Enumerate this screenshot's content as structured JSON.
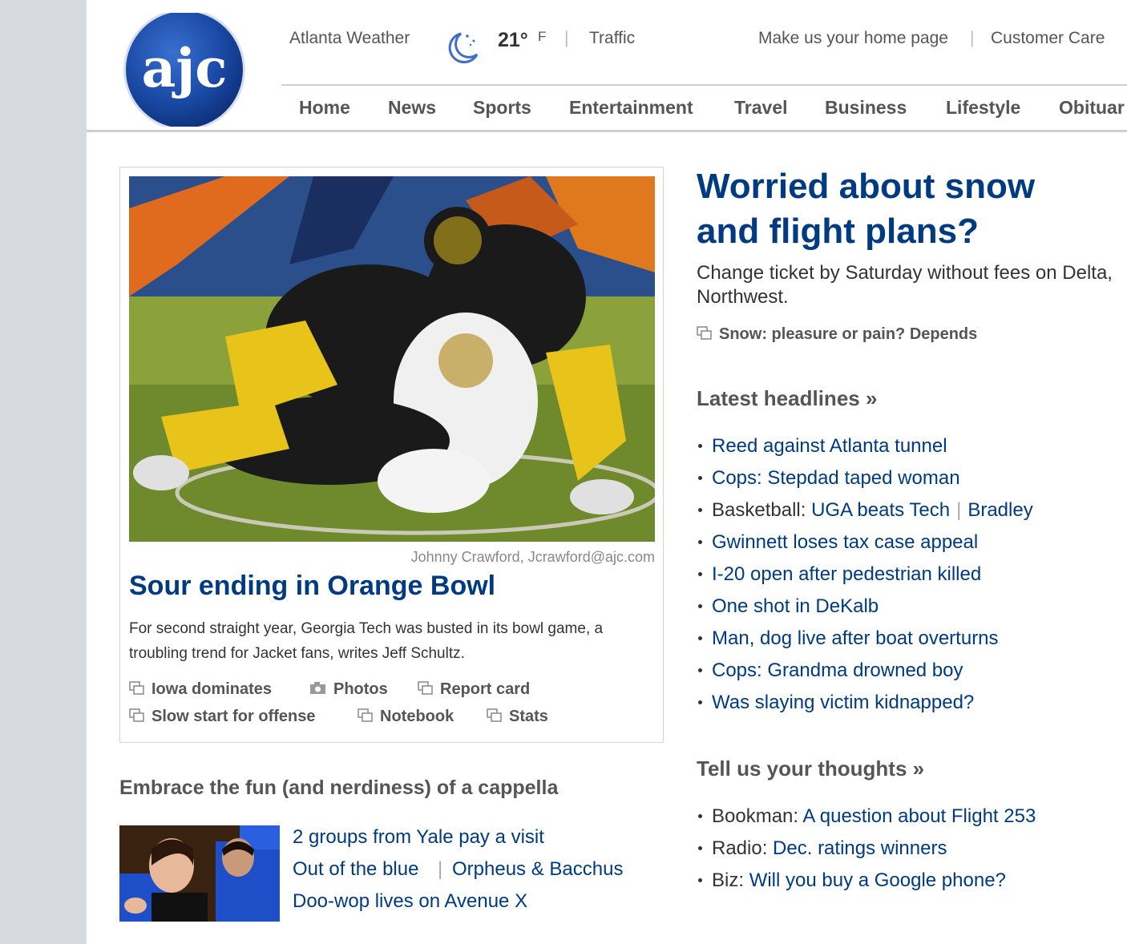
{
  "header": {
    "logo_text": "ajc",
    "weather_label": "Atlanta Weather",
    "weather_icon": "moon-night-icon",
    "temperature": "21°",
    "temperature_unit": "F",
    "separator": "|",
    "traffic_label": "Traffic",
    "homepage_label": "Make us your home page",
    "customer_care_label": "Customer Care"
  },
  "nav": {
    "items": [
      {
        "label": "Home"
      },
      {
        "label": "News"
      },
      {
        "label": "Sports"
      },
      {
        "label": "Entertainment"
      },
      {
        "label": "Travel"
      },
      {
        "label": "Business"
      },
      {
        "label": "Lifestyle"
      },
      {
        "label": "Obituar"
      }
    ]
  },
  "main_story": {
    "photo_credit": "Johnny Crawford, Jcrawford@ajc.com",
    "title": "Sour ending in Orange Bowl",
    "description": "For second straight year, Georgia Tech was busted in its bowl game, a troubling trend for Jacket fans, writes Jeff Schultz.",
    "related": [
      {
        "label": "Iowa dominates",
        "icon": "article-icon"
      },
      {
        "label": "Photos",
        "icon": "camera-icon"
      },
      {
        "label": "Report card",
        "icon": "article-icon"
      },
      {
        "label": "Slow start for offense",
        "icon": "article-icon"
      },
      {
        "label": "Notebook",
        "icon": "article-icon"
      },
      {
        "label": "Stats",
        "icon": "article-icon"
      }
    ]
  },
  "acappella": {
    "title": "Embrace the fun (and nerdiness) of a cappella",
    "links": [
      "2 groups from Yale pay a visit",
      "Out of the blue",
      "Orpheus & Bacchus",
      "Doo-wop lives on Avenue X"
    ],
    "separator": "|"
  },
  "promo": {
    "title": "Worried about snow and flight plans?",
    "description": "Change ticket by Saturday without fees on Delta, Northwest.",
    "related_link": "Snow: pleasure or pain? Depends"
  },
  "latest": {
    "title": "Latest headlines »",
    "items": [
      {
        "prefix": "",
        "link": "Reed against Atlanta tunnel"
      },
      {
        "prefix": "",
        "link": "Cops: Stepdad taped woman"
      },
      {
        "prefix": "Basketball: ",
        "link": "UGA beats Tech",
        "separator": "|",
        "link2": "Bradley"
      },
      {
        "prefix": "",
        "link": "Gwinnett loses tax case appeal"
      },
      {
        "prefix": "",
        "link": "I-20 open after pedestrian killed"
      },
      {
        "prefix": "",
        "link": "One shot in DeKalb"
      },
      {
        "prefix": "",
        "link": "Man, dog live after boat overturns"
      },
      {
        "prefix": "",
        "link": "Cops: Grandma drowned boy"
      },
      {
        "prefix": "",
        "link": "Was slaying victim kidnapped?"
      }
    ]
  },
  "thoughts": {
    "title": "Tell us your thoughts  »",
    "items": [
      {
        "prefix": "Bookman: ",
        "link": "A question about Flight 253"
      },
      {
        "prefix": "Radio: ",
        "link": "Dec. ratings winners"
      },
      {
        "prefix": "Biz: ",
        "link": "Will you buy a Google phone?"
      }
    ]
  },
  "colors": {
    "link_blue": "#003a80",
    "logo_blue": "#1a4aa6",
    "gutter_gray": "#d7dbdf"
  }
}
